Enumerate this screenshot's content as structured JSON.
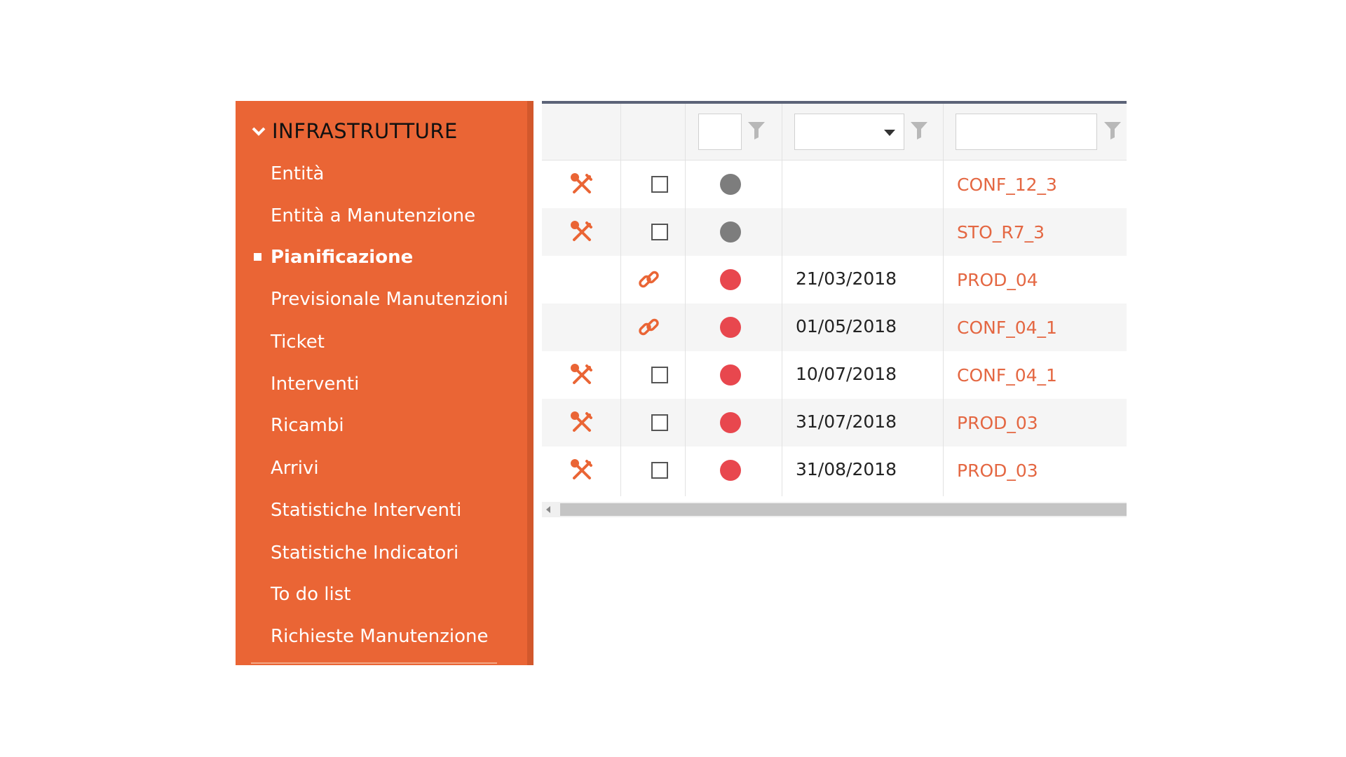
{
  "sidebar": {
    "header": "INFRASTRUTTURE",
    "items": [
      {
        "label": "Entità",
        "active": false
      },
      {
        "label": "Entità a Manutenzione",
        "active": false
      },
      {
        "label": "Pianificazione",
        "active": true
      },
      {
        "label": "Previsionale Manutenzioni",
        "active": false
      },
      {
        "label": "Ticket",
        "active": false
      },
      {
        "label": "Interventi",
        "active": false
      },
      {
        "label": "Ricambi",
        "active": false
      },
      {
        "label": "Arrivi",
        "active": false
      },
      {
        "label": "Statistiche Interventi",
        "active": false
      },
      {
        "label": "Statistiche Indicatori",
        "active": false
      },
      {
        "label": "To do list",
        "active": false
      },
      {
        "label": "Richieste Manutenzione",
        "active": false
      }
    ],
    "colors": {
      "background": "#ea6535",
      "text": "#ffffff",
      "header_text": "#111111"
    }
  },
  "grid": {
    "filters": {
      "status_filter_value": "",
      "date_filter_value": "",
      "code_filter_value": ""
    },
    "rows": [
      {
        "action_icon": "tools-icon",
        "has_checkbox": true,
        "status": "grey",
        "date": "",
        "code": "CONF_12_3"
      },
      {
        "action_icon": "tools-icon",
        "has_checkbox": true,
        "status": "grey",
        "date": "",
        "code": "STO_R7_3"
      },
      {
        "action_icon": "",
        "link_icon": "link-icon",
        "has_checkbox": false,
        "status": "red",
        "date": "21/03/2018",
        "code": "PROD_04"
      },
      {
        "action_icon": "",
        "link_icon": "link-icon",
        "has_checkbox": false,
        "status": "red",
        "date": "01/05/2018",
        "code": "CONF_04_1"
      },
      {
        "action_icon": "tools-icon",
        "has_checkbox": true,
        "status": "red",
        "date": "10/07/2018",
        "code": "CONF_04_1"
      },
      {
        "action_icon": "tools-icon",
        "has_checkbox": true,
        "status": "red",
        "date": "31/07/2018",
        "code": "PROD_03"
      },
      {
        "action_icon": "tools-icon",
        "has_checkbox": true,
        "status": "red",
        "date": "31/08/2018",
        "code": "PROD_03"
      }
    ],
    "colors": {
      "status_grey": "#7d7d7d",
      "status_red": "#e8474e",
      "link": "#e46742",
      "accent": "#ea6535"
    }
  }
}
